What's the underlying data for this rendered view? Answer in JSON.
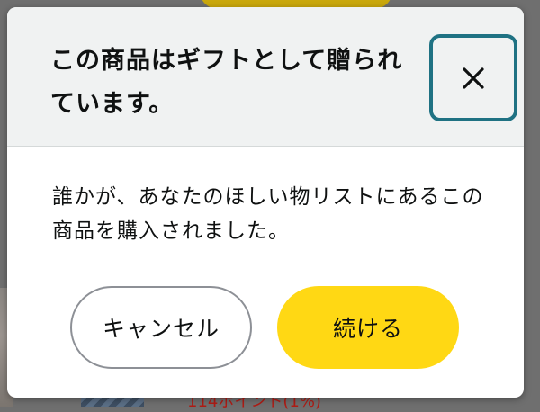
{
  "background": {
    "points_text": "114ポイント(1%)"
  },
  "dialog": {
    "title": "この商品はギフトとして贈られています。",
    "body": "誰かが、あなたのほしい物リストにあるこの商品を購入されました。",
    "close_icon": "close-icon",
    "buttons": {
      "cancel": "キャンセル",
      "continue": "続ける"
    }
  },
  "colors": {
    "accent_focus": "#1f7283",
    "primary_button": "#ffd814",
    "header_bg": "#f0f2f2"
  }
}
